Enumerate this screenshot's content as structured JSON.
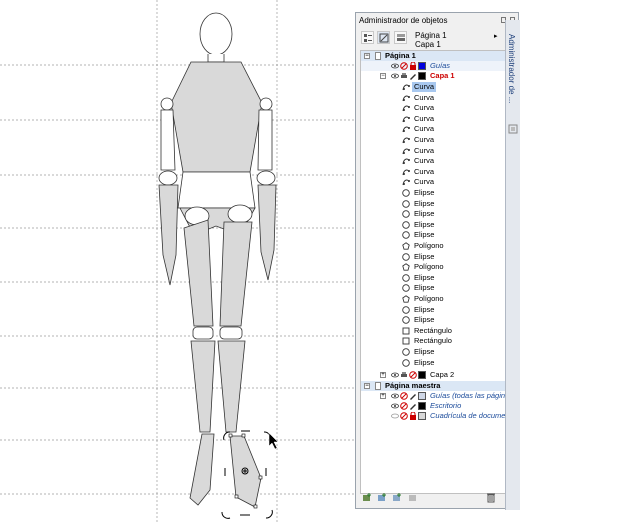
{
  "panel": {
    "title": "Administrador de objetos",
    "page_label": "Página 1",
    "layer_label": "Capa 1",
    "side_tab": "Administrador de ..."
  },
  "colors": {
    "guides_swatch": "#0000dd",
    "layer1_swatch": "#000000",
    "layer2_swatch": "#000000",
    "selection": "#a8c8ef",
    "figure_fill": "#d9d9d9"
  },
  "tree": {
    "page1": {
      "label": "Página 1"
    },
    "guides": {
      "label": "Guías"
    },
    "layer1": {
      "label": "Capa 1"
    },
    "objects": [
      {
        "label": "Curva",
        "icon": "curve-icon"
      },
      {
        "label": "Curva",
        "icon": "curve-icon"
      },
      {
        "label": "Curva",
        "icon": "curve-icon"
      },
      {
        "label": "Curva",
        "icon": "curve-icon"
      },
      {
        "label": "Curva",
        "icon": "curve-icon"
      },
      {
        "label": "Curva",
        "icon": "curve-icon"
      },
      {
        "label": "Curva",
        "icon": "curve-icon"
      },
      {
        "label": "Curva",
        "icon": "curve-icon"
      },
      {
        "label": "Curva",
        "icon": "curve-icon"
      },
      {
        "label": "Curva",
        "icon": "curve-icon"
      },
      {
        "label": "Elipse",
        "icon": "ellipse-icon"
      },
      {
        "label": "Elipse",
        "icon": "ellipse-icon"
      },
      {
        "label": "Elipse",
        "icon": "ellipse-icon"
      },
      {
        "label": "Elipse",
        "icon": "ellipse-icon"
      },
      {
        "label": "Elipse",
        "icon": "ellipse-icon"
      },
      {
        "label": "Polígono",
        "icon": "polygon-icon"
      },
      {
        "label": "Elipse",
        "icon": "ellipse-icon"
      },
      {
        "label": "Polígono",
        "icon": "polygon-icon"
      },
      {
        "label": "Elipse",
        "icon": "ellipse-icon"
      },
      {
        "label": "Elipse",
        "icon": "ellipse-icon"
      },
      {
        "label": "Polígono",
        "icon": "polygon-icon"
      },
      {
        "label": "Elipse",
        "icon": "ellipse-icon"
      },
      {
        "label": "Elipse",
        "icon": "ellipse-icon"
      },
      {
        "label": "Rectángulo",
        "icon": "rectangle-icon"
      },
      {
        "label": "Rectángulo",
        "icon": "rectangle-icon"
      },
      {
        "label": "Elipse",
        "icon": "ellipse-icon"
      },
      {
        "label": "Elipse",
        "icon": "ellipse-icon"
      }
    ],
    "layer2": {
      "label": "Capa 2"
    },
    "master": {
      "label": "Página maestra"
    },
    "master_guides": {
      "label": "Guías (todas las páginas)"
    },
    "desktop": {
      "label": "Escritorio"
    },
    "grid": {
      "label": "Cuadrícula de documento"
    }
  }
}
